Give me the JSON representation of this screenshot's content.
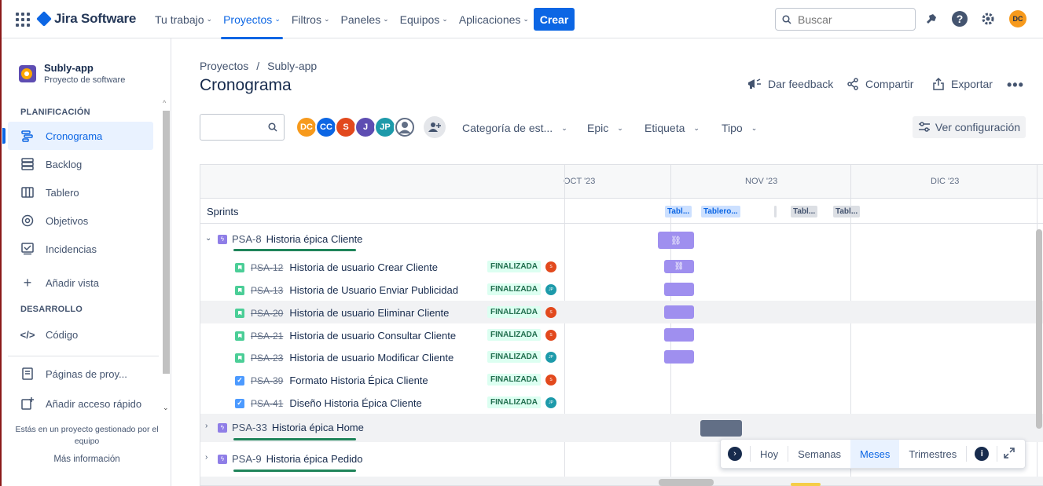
{
  "topnav": {
    "app_name": "Jira Software",
    "items": [
      {
        "label": "Tu trabajo",
        "active": false
      },
      {
        "label": "Proyectos",
        "active": true
      },
      {
        "label": "Filtros",
        "active": false
      },
      {
        "label": "Paneles",
        "active": false
      },
      {
        "label": "Equipos",
        "active": false
      },
      {
        "label": "Aplicaciones",
        "active": false
      }
    ],
    "create_label": "Crear",
    "search_placeholder": "Buscar",
    "user_initials": "DC",
    "accent": "#0c66e4"
  },
  "sidebar": {
    "project_name": "Subly-app",
    "project_type": "Proyecto de software",
    "planning_title": "PLANIFICACIÓN",
    "planning_items": [
      {
        "label": "Cronograma",
        "icon": "timeline-icon",
        "active": true
      },
      {
        "label": "Backlog",
        "icon": "backlog-icon",
        "active": false
      },
      {
        "label": "Tablero",
        "icon": "board-icon",
        "active": false
      },
      {
        "label": "Objetivos",
        "icon": "goals-icon",
        "active": false
      },
      {
        "label": "Incidencias",
        "icon": "issues-icon",
        "active": false
      }
    ],
    "add_view": "Añadir vista",
    "dev_title": "DESARROLLO",
    "code_item": "Código",
    "pages_item": "Páginas de proy...",
    "shortcut_item": "Añadir acceso rápido",
    "footer_note": "Estás en un proyecto gestionado por el equipo",
    "footer_link": "Más información"
  },
  "main": {
    "breadcrumb": [
      "Proyectos",
      "/",
      "Subly-app"
    ],
    "title": "Cronograma",
    "actions": {
      "feedback": "Dar feedback",
      "share": "Compartir",
      "export": "Exportar"
    },
    "filter_avatars": [
      {
        "initials": "DC",
        "color": "#f79a1c"
      },
      {
        "initials": "CC",
        "color": "#0c66e4"
      },
      {
        "initials": "S",
        "color": "#e2491d"
      },
      {
        "initials": "J",
        "color": "#5e4db2"
      },
      {
        "initials": "JP",
        "color": "#1d9aaa"
      },
      {
        "initials": "",
        "color": "#626f86"
      }
    ],
    "filters": [
      "Categoría de est...",
      "Epic",
      "Etiqueta",
      "Tipo"
    ],
    "config_label": "Ver configuración"
  },
  "timeline": {
    "months": [
      "OCT '23",
      "NOV '23",
      "DIC '23"
    ],
    "sprints_label": "Sprints",
    "sprint_chips": [
      "Tabl...",
      "Tablero...",
      "Tabl...",
      "Tabl..."
    ],
    "epics": [
      {
        "key": "PSA-8",
        "title": "Historia épica Cliente",
        "expanded": true
      },
      {
        "key": "PSA-33",
        "title": "Historia épica Home",
        "expanded": false
      },
      {
        "key": "PSA-9",
        "title": "Historia épica Pedido",
        "expanded": false
      }
    ],
    "issues": [
      {
        "key": "PSA-12",
        "title": "Historia de usuario Crear Cliente",
        "status": "FINALIZADA",
        "assignee": "S",
        "type": "story"
      },
      {
        "key": "PSA-13",
        "title": "Historia de Usuario Enviar Publicidad",
        "status": "FINALIZADA",
        "assignee": "JP",
        "type": "story"
      },
      {
        "key": "PSA-20",
        "title": "Historia de usuario Eliminar Cliente",
        "status": "FINALIZADA",
        "assignee": "S",
        "type": "story"
      },
      {
        "key": "PSA-21",
        "title": "Historia de usuario Consultar Cliente",
        "status": "FINALIZADA",
        "assignee": "S",
        "type": "story"
      },
      {
        "key": "PSA-23",
        "title": "Historia de usuario Modificar Cliente",
        "status": "FINALIZADA",
        "assignee": "JP",
        "type": "story"
      },
      {
        "key": "PSA-39",
        "title": "Formato Historia Épica Cliente",
        "status": "FINALIZADA",
        "assignee": "S",
        "type": "task"
      },
      {
        "key": "PSA-41",
        "title": "Diseño Historia Épica Cliente",
        "status": "FINALIZADA",
        "assignee": "JP",
        "type": "task"
      }
    ]
  },
  "view_controls": {
    "buttons": [
      "Hoy",
      "Semanas",
      "Meses",
      "Trimestres"
    ],
    "active": "Meses"
  }
}
